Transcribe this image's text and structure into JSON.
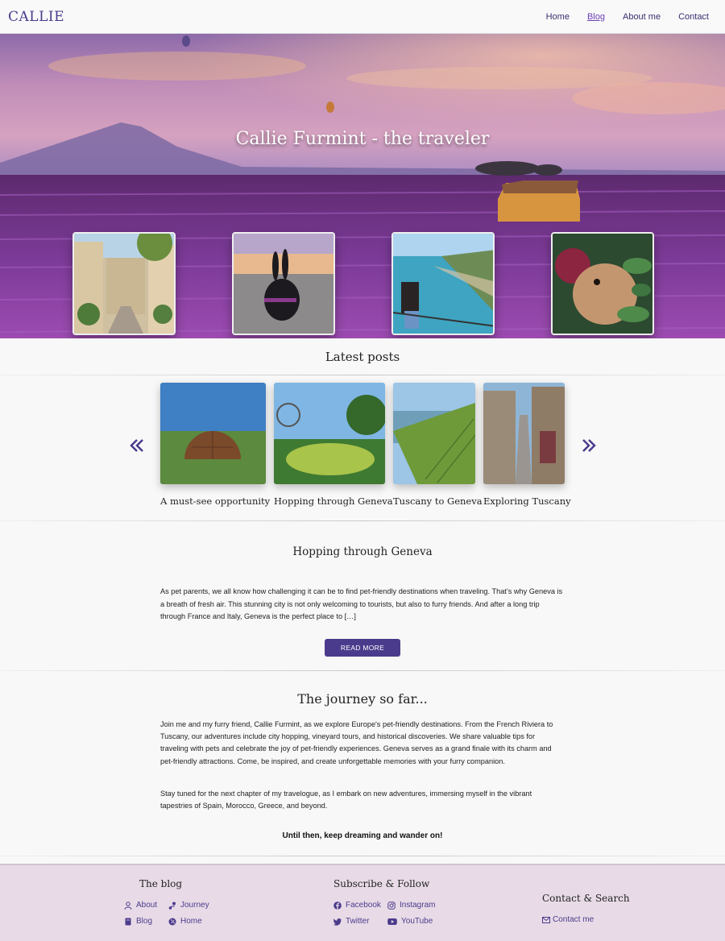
{
  "nav": {
    "brand": "CALLIE",
    "links": [
      "Home",
      "Blog",
      "About me",
      "Contact"
    ],
    "active": "Blog"
  },
  "hero": {
    "title": "Callie Furmint - the traveler"
  },
  "latest": {
    "title": "Latest posts",
    "prev_icon": "double-chevron-left-icon",
    "next_icon": "double-chevron-right-icon",
    "posts": [
      {
        "caption": "A must-see opportunity"
      },
      {
        "caption": "Hopping through Geneva"
      },
      {
        "caption": "Tuscany to Geneva"
      },
      {
        "caption": "Exploring Tuscany"
      }
    ]
  },
  "featured": {
    "title": "Hopping through Geneva",
    "excerpt": "As pet parents, we all know how challenging it can be to find pet-friendly destinations when traveling. That’s why Geneva is a breath of fresh air. This stunning city is not only welcoming to tourists, but also to furry friends. And after a long trip through France and Italy, Geneva is the perfect place to […]",
    "button": "READ MORE"
  },
  "journey": {
    "title": "The journey so far...",
    "p1": "Join me and my furry friend, Callie Furmint, as we explore Europe's pet-friendly destinations. From the French Riviera to Tuscany, our adventures include city hopping, vineyard tours, and historical discoveries. We share valuable tips for traveling with pets and celebrate the joy of pet-friendly experiences. Geneva serves as a grand finale with its charm and pet-friendly attractions. Come, be inspired, and create unforgettable memories with your furry companion.",
    "p2": "Stay tuned for the next chapter of my travelogue, as I embark on new adventures, immersing myself in the vibrant tapestries of Spain, Morocco, Greece, and beyond.",
    "signoff": "Until then, keep dreaming and wander on!"
  },
  "footer": {
    "blog": {
      "title": "The blog",
      "links": [
        {
          "label": "About",
          "icon": "user-icon"
        },
        {
          "label": "Journey",
          "icon": "route-icon"
        },
        {
          "label": "Blog",
          "icon": "book-icon"
        },
        {
          "label": "Home",
          "icon": "globe-icon"
        }
      ]
    },
    "social": {
      "title": "Subscribe & Follow",
      "links": [
        {
          "label": "Facebook",
          "icon": "facebook-icon"
        },
        {
          "label": "Instagram",
          "icon": "instagram-icon"
        },
        {
          "label": "Twitter",
          "icon": "twitter-icon"
        },
        {
          "label": "YouTube",
          "icon": "youtube-icon"
        }
      ]
    },
    "contact": {
      "title": "Contact & Search",
      "link": {
        "label": "Contact me",
        "icon": "envelope-icon"
      }
    }
  },
  "colors": {
    "accent": "#4b3b8c",
    "footer_bg": "#e8dbe7",
    "lavender": "#7a3d97"
  }
}
